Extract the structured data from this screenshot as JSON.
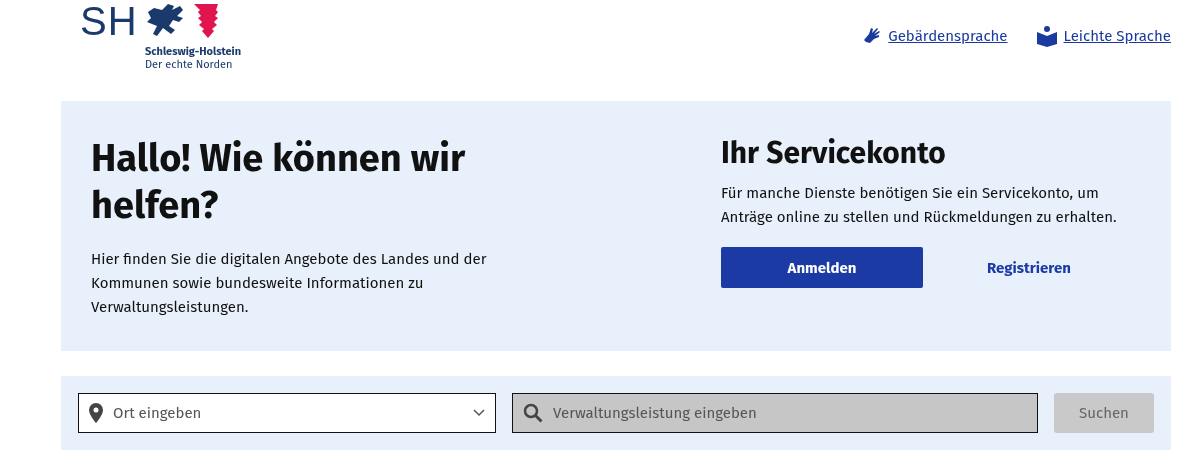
{
  "logo": {
    "letters": "SH",
    "name": "Schleswig-Holstein",
    "slogan": "Der echte Norden"
  },
  "header_links": [
    {
      "kind": "sign",
      "label": "Gebärdensprache"
    },
    {
      "kind": "easy",
      "label": "Leichte Sprache"
    }
  ],
  "hero": {
    "title": "Hallo! Wie können wir helfen?",
    "text": "Hier finden Sie die digitalen Angebote des Landes und der Kommunen sowie bundesweite Informationen zu Verwaltungsleistungen."
  },
  "servicekonto": {
    "title": "Ihr Servicekonto",
    "text": "Für manche Dienste benötigen Sie ein Servicekonto, um Anträge online zu stellen und Rückmeldungen zu erhalten.",
    "login": "Anmelden",
    "register": "Registrieren"
  },
  "search": {
    "location_placeholder": "Ort eingeben",
    "service_placeholder": "Verwaltungsleistung eingeben",
    "service_disabled": true,
    "button": "Suchen",
    "button_disabled": true
  }
}
